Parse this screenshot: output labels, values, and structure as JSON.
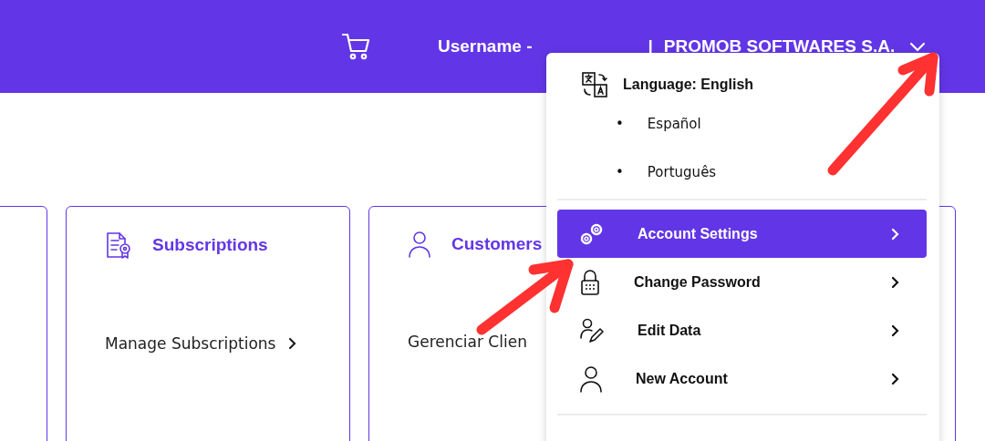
{
  "header": {
    "username": "Username -",
    "separator": "|",
    "company": "PROMOB SOFTWARES S.A.",
    "menu_expanded": true
  },
  "cards": [
    {
      "kind": "blank"
    },
    {
      "kind": "feature",
      "title": "Subscriptions",
      "link": "Manage Subscriptions"
    },
    {
      "kind": "feature",
      "title": "Customers",
      "link": "Gerenciar Clien"
    },
    {
      "kind": "blank"
    }
  ],
  "dropdown": {
    "language": "Language: English",
    "languages": [
      {
        "marker": "•",
        "label": "Español"
      },
      {
        "marker": "•",
        "label": "Português"
      }
    ],
    "items": [
      {
        "label": "Account Settings",
        "selected": true
      },
      {
        "label": "Change Password",
        "selected": false
      },
      {
        "label": "Edit Data",
        "selected": false
      },
      {
        "label": "New Account",
        "selected": false
      }
    ]
  },
  "annotations": [
    {
      "kind": "arrow"
    },
    {
      "kind": "arrow"
    }
  ]
}
